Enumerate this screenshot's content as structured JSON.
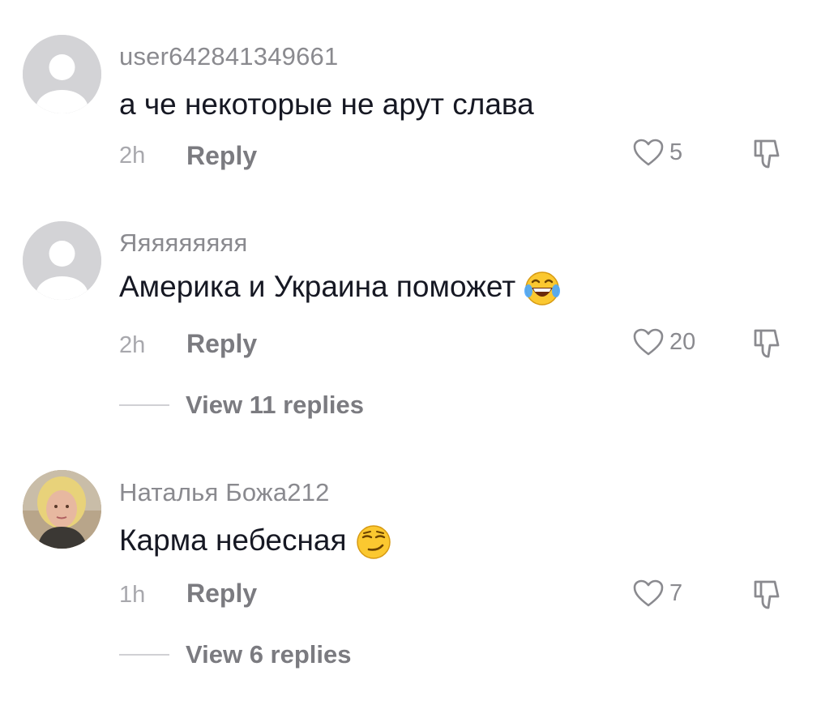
{
  "comments": [
    {
      "username": "user642841349661",
      "text": "а че некоторые не арут слава",
      "time": "2h",
      "reply_label": "Reply",
      "likes": "5",
      "emoji": ""
    },
    {
      "username": "Яяяяяяяяя",
      "text": "Америка и Украина поможет",
      "time": "2h",
      "reply_label": "Reply",
      "likes": "20",
      "emoji": "face-with-tears-of-joy",
      "view_replies": "View 11 replies"
    },
    {
      "username": "Наталья Божа212",
      "text": "Карма небесная",
      "time": "1h",
      "reply_label": "Reply",
      "likes": "7",
      "emoji": "smirking-face",
      "view_replies": "View 6 replies"
    }
  ],
  "colors": {
    "username": "#8a8a8f",
    "text": "#161823",
    "secondary": "#7b7b80",
    "avatar_placeholder": "#d3d3d6"
  }
}
